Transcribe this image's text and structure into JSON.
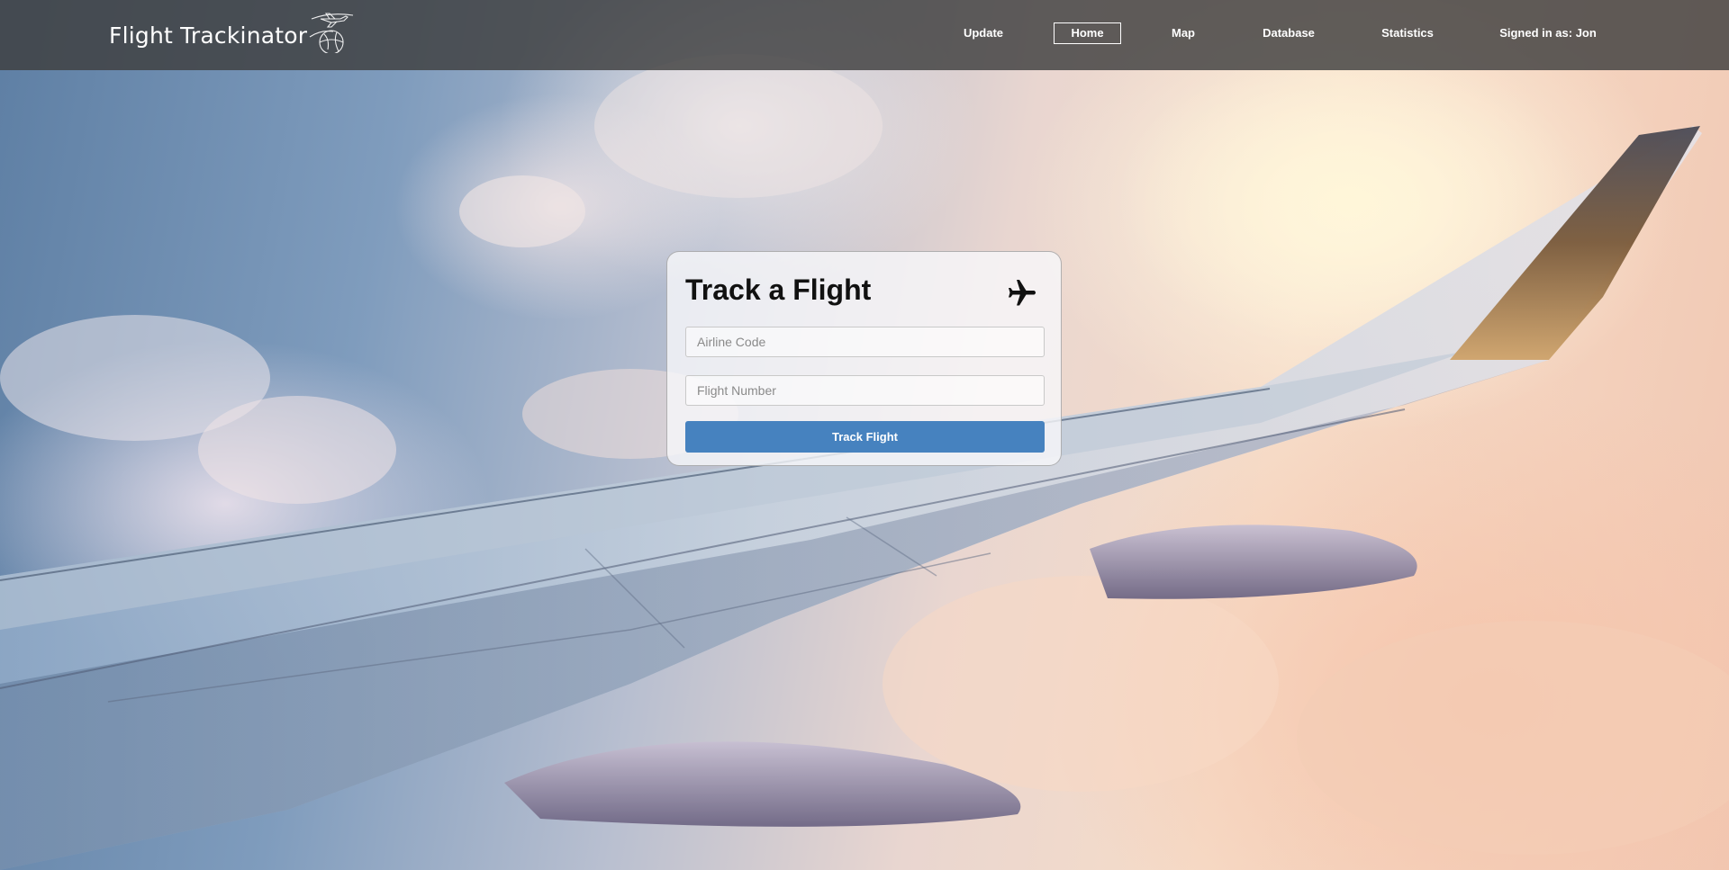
{
  "header": {
    "brand": "Flight Trackinator",
    "logo_icon": "plane-over-globe-icon",
    "nav": [
      {
        "label": "Update",
        "active": false
      },
      {
        "label": "Home",
        "active": true
      },
      {
        "label": "Map",
        "active": false
      },
      {
        "label": "Database",
        "active": false
      },
      {
        "label": "Statistics",
        "active": false
      }
    ],
    "signed_in": "Signed in as: Jon"
  },
  "form": {
    "title": "Track a Flight",
    "title_icon": "airplane-icon",
    "airline_placeholder": "Airline Code",
    "airline_value": "",
    "flight_placeholder": "Flight Number",
    "flight_value": "",
    "submit_label": "Track Flight"
  },
  "colors": {
    "topbar": "#3e3e3e",
    "accent_button": "#4682bf",
    "nav_text": "#ffffff"
  }
}
